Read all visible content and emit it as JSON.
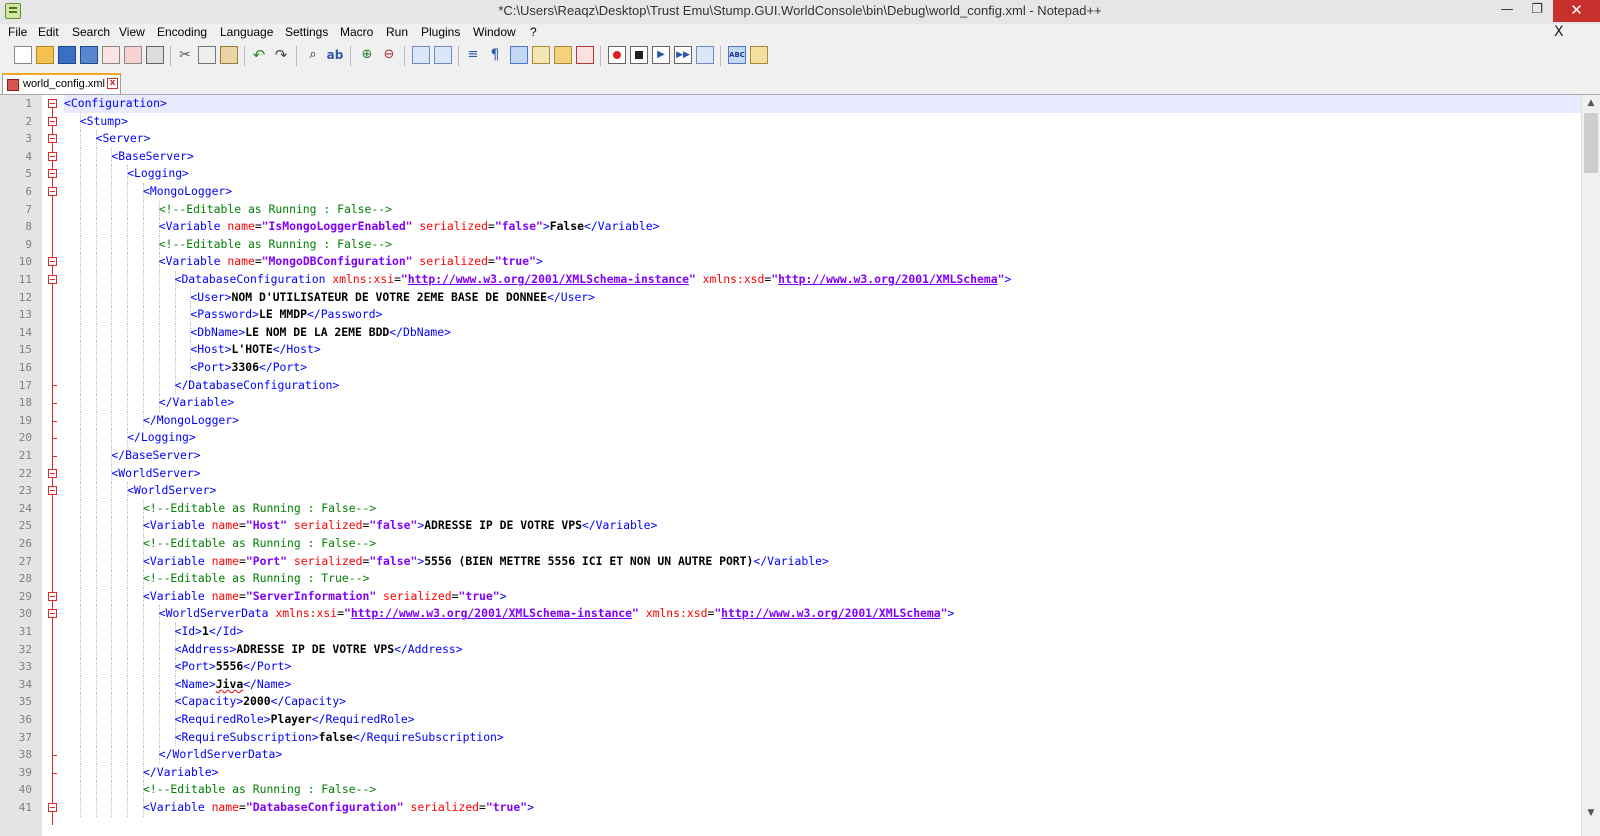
{
  "window": {
    "title": "*C:\\Users\\Reaqz\\Desktop\\Trust Emu\\Stump.GUI.WorldConsole\\bin\\Debug\\world_config.xml - Notepad++",
    "minimize_glyph": "—",
    "restore_glyph": "❐",
    "close_glyph": "✕"
  },
  "menu": {
    "items": [
      "File",
      "Edit",
      "Search",
      "View",
      "Encoding",
      "Language",
      "Settings",
      "Macro",
      "Run",
      "Plugins",
      "Window",
      "?"
    ],
    "close_glyph": "X"
  },
  "toolbar": {
    "icons": [
      "new-file-icon",
      "open-file-icon",
      "save-icon",
      "save-all-icon",
      "close-icon",
      "close-all-icon",
      "print-icon",
      "cut-icon",
      "copy-icon",
      "paste-icon",
      "undo-icon",
      "redo-icon",
      "find-icon",
      "replace-icon",
      "zoom-in-icon",
      "zoom-out-icon",
      "sync-vertical-icon",
      "sync-horizontal-icon",
      "word-wrap-icon",
      "show-all-characters-icon",
      "indent-guide-icon",
      "fold-all-icon",
      "document-map-icon",
      "function-list-icon",
      "record-macro-icon",
      "stop-recording-icon",
      "playback-macro-icon",
      "run-macro-multiple-icon",
      "save-macro-icon",
      "spell-check-icon",
      "spell-check-options-icon"
    ]
  },
  "tab": {
    "label": "world_config.xml",
    "close_glyph": "x"
  },
  "colors": {
    "tag": "#0000ff",
    "attribute": "#ff0000",
    "value": "#8000ff",
    "comment": "#008000",
    "fold_marker": "#e0282b",
    "current_line": "#e8e8ff"
  },
  "editor": {
    "lines": [
      {
        "n": "1",
        "indent": 0,
        "fold": "open",
        "parts": [
          [
            "tag",
            "<Configuration>"
          ]
        ]
      },
      {
        "n": "2",
        "indent": 1,
        "fold": "open",
        "parts": [
          [
            "tag",
            "<Stump>"
          ]
        ]
      },
      {
        "n": "3",
        "indent": 2,
        "fold": "open",
        "parts": [
          [
            "tag",
            "<Server>"
          ]
        ]
      },
      {
        "n": "4",
        "indent": 3,
        "fold": "open",
        "parts": [
          [
            "tag",
            "<BaseServer>"
          ]
        ]
      },
      {
        "n": "5",
        "indent": 4,
        "fold": "open",
        "parts": [
          [
            "tag",
            "<Logging>"
          ]
        ]
      },
      {
        "n": "6",
        "indent": 5,
        "fold": "open",
        "parts": [
          [
            "tag",
            "<MongoLogger>"
          ]
        ]
      },
      {
        "n": "7",
        "indent": 6,
        "fold": "",
        "parts": [
          [
            "cmt",
            "<!--Editable as Running : False-->"
          ]
        ]
      },
      {
        "n": "8",
        "indent": 6,
        "fold": "",
        "parts": [
          [
            "tag",
            "<Variable "
          ],
          [
            "attr",
            "name"
          ],
          [
            "sym",
            "="
          ],
          [
            "val",
            "\"IsMongoLoggerEnabled\""
          ],
          [
            "attr",
            " serialized"
          ],
          [
            "sym",
            "="
          ],
          [
            "val",
            "\"false\""
          ],
          [
            "tag",
            ">"
          ],
          [
            "txt",
            "False"
          ],
          [
            "tag",
            "</Variable>"
          ]
        ]
      },
      {
        "n": "9",
        "indent": 6,
        "fold": "",
        "parts": [
          [
            "cmt",
            "<!--Editable as Running : False-->"
          ]
        ]
      },
      {
        "n": "10",
        "indent": 6,
        "fold": "open",
        "parts": [
          [
            "tag",
            "<Variable "
          ],
          [
            "attr",
            "name"
          ],
          [
            "sym",
            "="
          ],
          [
            "val",
            "\"MongoDBConfiguration\""
          ],
          [
            "attr",
            " serialized"
          ],
          [
            "sym",
            "="
          ],
          [
            "val",
            "\"true\""
          ],
          [
            "tag",
            ">"
          ]
        ]
      },
      {
        "n": "11",
        "indent": 7,
        "fold": "open",
        "parts": [
          [
            "tag",
            "<DatabaseConfiguration "
          ],
          [
            "attr",
            "xmlns:xsi"
          ],
          [
            "sym",
            "="
          ],
          [
            "val",
            "\""
          ],
          [
            "url",
            "http://www.w3.org/2001/XMLSchema-instance"
          ],
          [
            "val",
            "\""
          ],
          [
            "attr",
            " xmlns:xsd"
          ],
          [
            "sym",
            "="
          ],
          [
            "val",
            "\""
          ],
          [
            "url",
            "http://www.w3.org/2001/XMLSchema"
          ],
          [
            "val",
            "\""
          ],
          [
            "tag",
            ">"
          ]
        ]
      },
      {
        "n": "12",
        "indent": 8,
        "fold": "",
        "parts": [
          [
            "tag",
            "<User>"
          ],
          [
            "txt",
            "NOM D'UTILISATEUR DE VOTRE 2EME BASE DE DONNEE"
          ],
          [
            "tag",
            "</User>"
          ]
        ]
      },
      {
        "n": "13",
        "indent": 8,
        "fold": "",
        "parts": [
          [
            "tag",
            "<Password>"
          ],
          [
            "txt",
            "LE MMDP"
          ],
          [
            "tag",
            "</Password>"
          ]
        ]
      },
      {
        "n": "14",
        "indent": 8,
        "fold": "",
        "parts": [
          [
            "tag",
            "<DbName>"
          ],
          [
            "txt",
            "LE NOM DE LA 2EME BDD"
          ],
          [
            "tag",
            "</DbName>"
          ]
        ]
      },
      {
        "n": "15",
        "indent": 8,
        "fold": "",
        "parts": [
          [
            "tag",
            "<Host>"
          ],
          [
            "txt",
            "L'HOTE"
          ],
          [
            "tag",
            "</Host>"
          ]
        ]
      },
      {
        "n": "16",
        "indent": 8,
        "fold": "",
        "parts": [
          [
            "tag",
            "<Port>"
          ],
          [
            "txt",
            "3306"
          ],
          [
            "tag",
            "</Port>"
          ]
        ]
      },
      {
        "n": "17",
        "indent": 7,
        "fold": "end",
        "parts": [
          [
            "tag",
            "</DatabaseConfiguration>"
          ]
        ]
      },
      {
        "n": "18",
        "indent": 6,
        "fold": "end",
        "parts": [
          [
            "tag",
            "</Variable>"
          ]
        ]
      },
      {
        "n": "19",
        "indent": 5,
        "fold": "end",
        "parts": [
          [
            "tag",
            "</MongoLogger>"
          ]
        ]
      },
      {
        "n": "20",
        "indent": 4,
        "fold": "end",
        "parts": [
          [
            "tag",
            "</Logging>"
          ]
        ]
      },
      {
        "n": "21",
        "indent": 3,
        "fold": "end",
        "parts": [
          [
            "tag",
            "</BaseServer>"
          ]
        ]
      },
      {
        "n": "22",
        "indent": 3,
        "fold": "open",
        "parts": [
          [
            "tag",
            "<WorldServer>"
          ]
        ]
      },
      {
        "n": "23",
        "indent": 4,
        "fold": "open",
        "parts": [
          [
            "tag",
            "<WorldServer>"
          ]
        ]
      },
      {
        "n": "24",
        "indent": 5,
        "fold": "",
        "parts": [
          [
            "cmt",
            "<!--Editable as Running : False-->"
          ]
        ]
      },
      {
        "n": "25",
        "indent": 5,
        "fold": "",
        "parts": [
          [
            "tag",
            "<Variable "
          ],
          [
            "attr",
            "name"
          ],
          [
            "sym",
            "="
          ],
          [
            "val",
            "\"Host\""
          ],
          [
            "attr",
            " serialized"
          ],
          [
            "sym",
            "="
          ],
          [
            "val",
            "\"false\""
          ],
          [
            "tag",
            ">"
          ],
          [
            "txt",
            "ADRESSE IP DE VOTRE VPS"
          ],
          [
            "tag",
            "</Variable>"
          ]
        ]
      },
      {
        "n": "26",
        "indent": 5,
        "fold": "",
        "parts": [
          [
            "cmt",
            "<!--Editable as Running : False-->"
          ]
        ]
      },
      {
        "n": "27",
        "indent": 5,
        "fold": "",
        "parts": [
          [
            "tag",
            "<Variable "
          ],
          [
            "attr",
            "name"
          ],
          [
            "sym",
            "="
          ],
          [
            "val",
            "\"Port\""
          ],
          [
            "attr",
            " serialized"
          ],
          [
            "sym",
            "="
          ],
          [
            "val",
            "\"false\""
          ],
          [
            "tag",
            ">"
          ],
          [
            "txt",
            "5556 (BIEN METTRE 5556 ICI ET NON UN AUTRE PORT)"
          ],
          [
            "tag",
            "</Variable>"
          ]
        ]
      },
      {
        "n": "28",
        "indent": 5,
        "fold": "",
        "parts": [
          [
            "cmt",
            "<!--Editable as Running : True-->"
          ]
        ]
      },
      {
        "n": "29",
        "indent": 5,
        "fold": "open",
        "parts": [
          [
            "tag",
            "<Variable "
          ],
          [
            "attr",
            "name"
          ],
          [
            "sym",
            "="
          ],
          [
            "val",
            "\"ServerInformation\""
          ],
          [
            "attr",
            " serialized"
          ],
          [
            "sym",
            "="
          ],
          [
            "val",
            "\"true\""
          ],
          [
            "tag",
            ">"
          ]
        ]
      },
      {
        "n": "30",
        "indent": 6,
        "fold": "open",
        "parts": [
          [
            "tag",
            "<WorldServerData "
          ],
          [
            "attr",
            "xmlns:xsi"
          ],
          [
            "sym",
            "="
          ],
          [
            "val",
            "\""
          ],
          [
            "url",
            "http://www.w3.org/2001/XMLSchema-instance"
          ],
          [
            "val",
            "\""
          ],
          [
            "attr",
            " xmlns:xsd"
          ],
          [
            "sym",
            "="
          ],
          [
            "val",
            "\""
          ],
          [
            "url",
            "http://www.w3.org/2001/XMLSchema"
          ],
          [
            "val",
            "\""
          ],
          [
            "tag",
            ">"
          ]
        ]
      },
      {
        "n": "31",
        "indent": 7,
        "fold": "",
        "parts": [
          [
            "tag",
            "<Id>"
          ],
          [
            "txt",
            "1"
          ],
          [
            "tag",
            "</Id>"
          ]
        ]
      },
      {
        "n": "32",
        "indent": 7,
        "fold": "",
        "parts": [
          [
            "tag",
            "<Address>"
          ],
          [
            "txt",
            "ADRESSE IP DE VOTRE VPS"
          ],
          [
            "tag",
            "</Address>"
          ]
        ]
      },
      {
        "n": "33",
        "indent": 7,
        "fold": "",
        "parts": [
          [
            "tag",
            "<Port>"
          ],
          [
            "txt",
            "5556"
          ],
          [
            "tag",
            "</Port>"
          ]
        ]
      },
      {
        "n": "34",
        "indent": 7,
        "fold": "",
        "parts": [
          [
            "tag",
            "<Name>"
          ],
          [
            "squig",
            "Jiva"
          ],
          [
            "tag",
            "</Name>"
          ]
        ]
      },
      {
        "n": "35",
        "indent": 7,
        "fold": "",
        "parts": [
          [
            "tag",
            "<Capacity>"
          ],
          [
            "txt",
            "2000"
          ],
          [
            "tag",
            "</Capacity>"
          ]
        ]
      },
      {
        "n": "36",
        "indent": 7,
        "fold": "",
        "parts": [
          [
            "tag",
            "<RequiredRole>"
          ],
          [
            "txt",
            "Player"
          ],
          [
            "tag",
            "</RequiredRole>"
          ]
        ]
      },
      {
        "n": "37",
        "indent": 7,
        "fold": "",
        "parts": [
          [
            "tag",
            "<RequireSubscription>"
          ],
          [
            "txt",
            "false"
          ],
          [
            "tag",
            "</RequireSubscription>"
          ]
        ]
      },
      {
        "n": "38",
        "indent": 6,
        "fold": "end",
        "parts": [
          [
            "tag",
            "</WorldServerData>"
          ]
        ]
      },
      {
        "n": "39",
        "indent": 5,
        "fold": "end",
        "parts": [
          [
            "tag",
            "</Variable>"
          ]
        ]
      },
      {
        "n": "40",
        "indent": 5,
        "fold": "",
        "parts": [
          [
            "cmt",
            "<!--Editable as Running : False-->"
          ]
        ]
      },
      {
        "n": "41",
        "indent": 5,
        "fold": "open",
        "parts": [
          [
            "tag",
            "<Variable "
          ],
          [
            "attr",
            "name"
          ],
          [
            "sym",
            "="
          ],
          [
            "val",
            "\"DatabaseConfiguration\""
          ],
          [
            "attr",
            " serialized"
          ],
          [
            "sym",
            "="
          ],
          [
            "val",
            "\"true\""
          ],
          [
            "tag",
            ">"
          ]
        ]
      }
    ]
  }
}
